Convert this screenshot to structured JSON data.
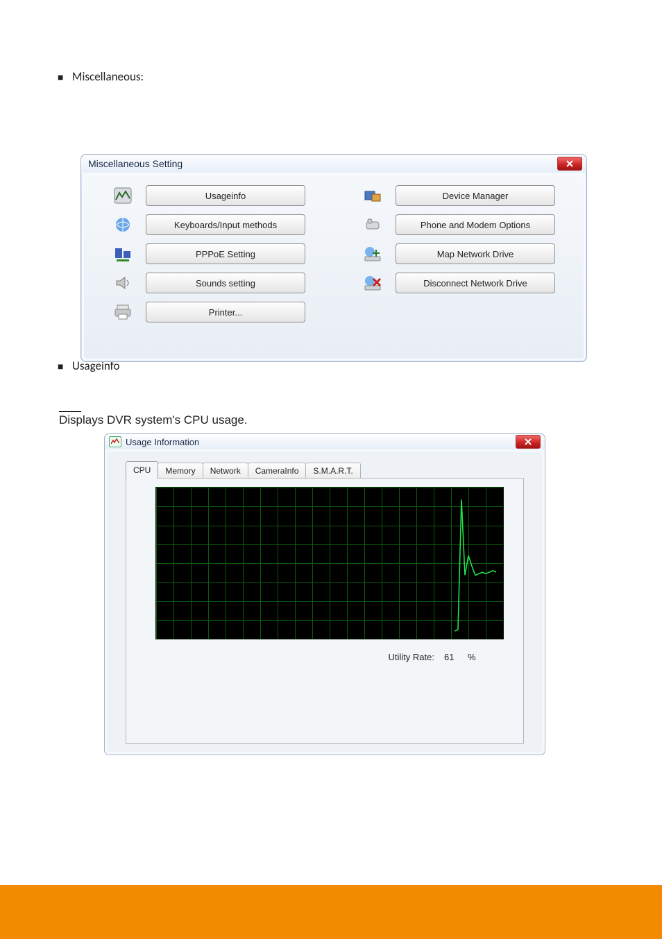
{
  "doc": {
    "miscellaneous_bullet": "Miscellaneous:",
    "usageinfo_bullet": "Usageinfo",
    "caption_cpu": "Displays DVR system's CPU usage."
  },
  "misc_dialog": {
    "title": "Miscellaneous Setting",
    "left_buttons": [
      "Usageinfo",
      "Keyboards/Input methods",
      "PPPoE Setting",
      "Sounds setting",
      "Printer..."
    ],
    "right_buttons": [
      "Device Manager",
      "Phone and Modem Options",
      "Map Network Drive",
      "Disconnect Network Drive"
    ]
  },
  "usage_dialog": {
    "title": "Usage Information",
    "tabs": [
      "CPU",
      "Memory",
      "Network",
      "CameraInfo",
      "S.M.A.R.T."
    ],
    "active_tab_index": 0,
    "utility_rate_label": "Utility Rate:",
    "utility_rate_value": "61",
    "utility_rate_unit": "%"
  },
  "chart_data": {
    "type": "line",
    "title": "",
    "xlabel": "",
    "ylabel": "",
    "x_range": [
      0,
      100
    ],
    "ylim": [
      0,
      100
    ],
    "grid_rows": 8,
    "grid_cols": 20,
    "series": [
      {
        "name": "CPU Utility Rate",
        "x": [
          86,
          87,
          88,
          89,
          90,
          91,
          92,
          93,
          94,
          95,
          96,
          97,
          98
        ],
        "values": [
          5,
          6,
          92,
          42,
          55,
          48,
          42,
          43,
          44,
          43,
          44,
          45,
          44
        ]
      }
    ]
  }
}
